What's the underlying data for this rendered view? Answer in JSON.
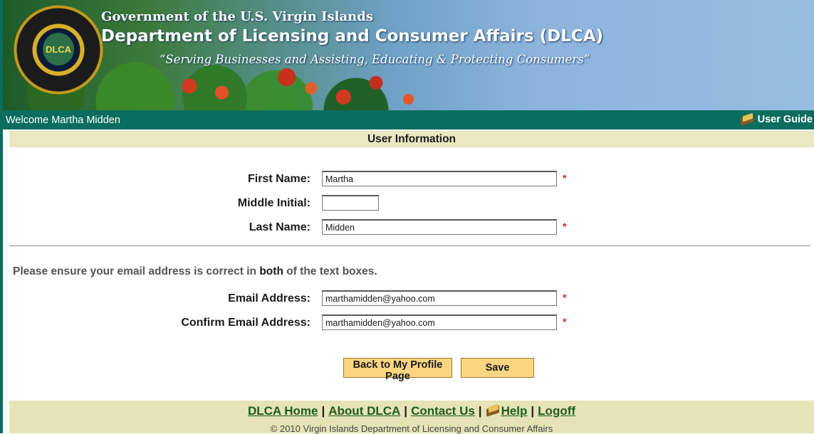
{
  "header": {
    "government": "Government of the U.S. Virgin Islands",
    "department": "Department of Licensing and Consumer Affairs (DLCA)",
    "slogan": "“Serving Businesses and Assisting, Educating & Protecting Consumers”",
    "seal_text": "DLCA"
  },
  "welcome_bar": {
    "welcome": "Welcome Martha Midden",
    "user_guide": "User Guide"
  },
  "section_title": "User Information",
  "name_fields": {
    "first_name_label": "First Name:",
    "first_name_value": "Martha",
    "middle_initial_label": "Middle Initial:",
    "middle_initial_value": "",
    "last_name_label": "Last Name:",
    "last_name_value": "Midden"
  },
  "email_notice": {
    "before": "Please ensure your email address is correct in ",
    "emphasis": "both",
    "after": " of the text boxes."
  },
  "email_fields": {
    "email_label": "Email Address:",
    "email_value": "marthamidden@yahoo.com",
    "confirm_label": "Confirm Email Address:",
    "confirm_value": "marthamidden@yahoo.com"
  },
  "required_marker": "*",
  "buttons": {
    "back": "Back to My Profile Page",
    "save": "Save"
  },
  "footer": {
    "links": {
      "home": "DLCA Home",
      "about": "About DLCA",
      "contact": "Contact Us",
      "help": "Help",
      "logoff": "Logoff"
    },
    "separator": "|",
    "copyright": "© 2010 Virgin Islands Department of Licensing and Consumer Affairs"
  },
  "colors": {
    "teal_bar": "#0b6d5e",
    "section_bg": "#ebe7c2",
    "button_bg": "#fbd582",
    "required": "#e02020",
    "footer_link": "#1c5c1c"
  }
}
